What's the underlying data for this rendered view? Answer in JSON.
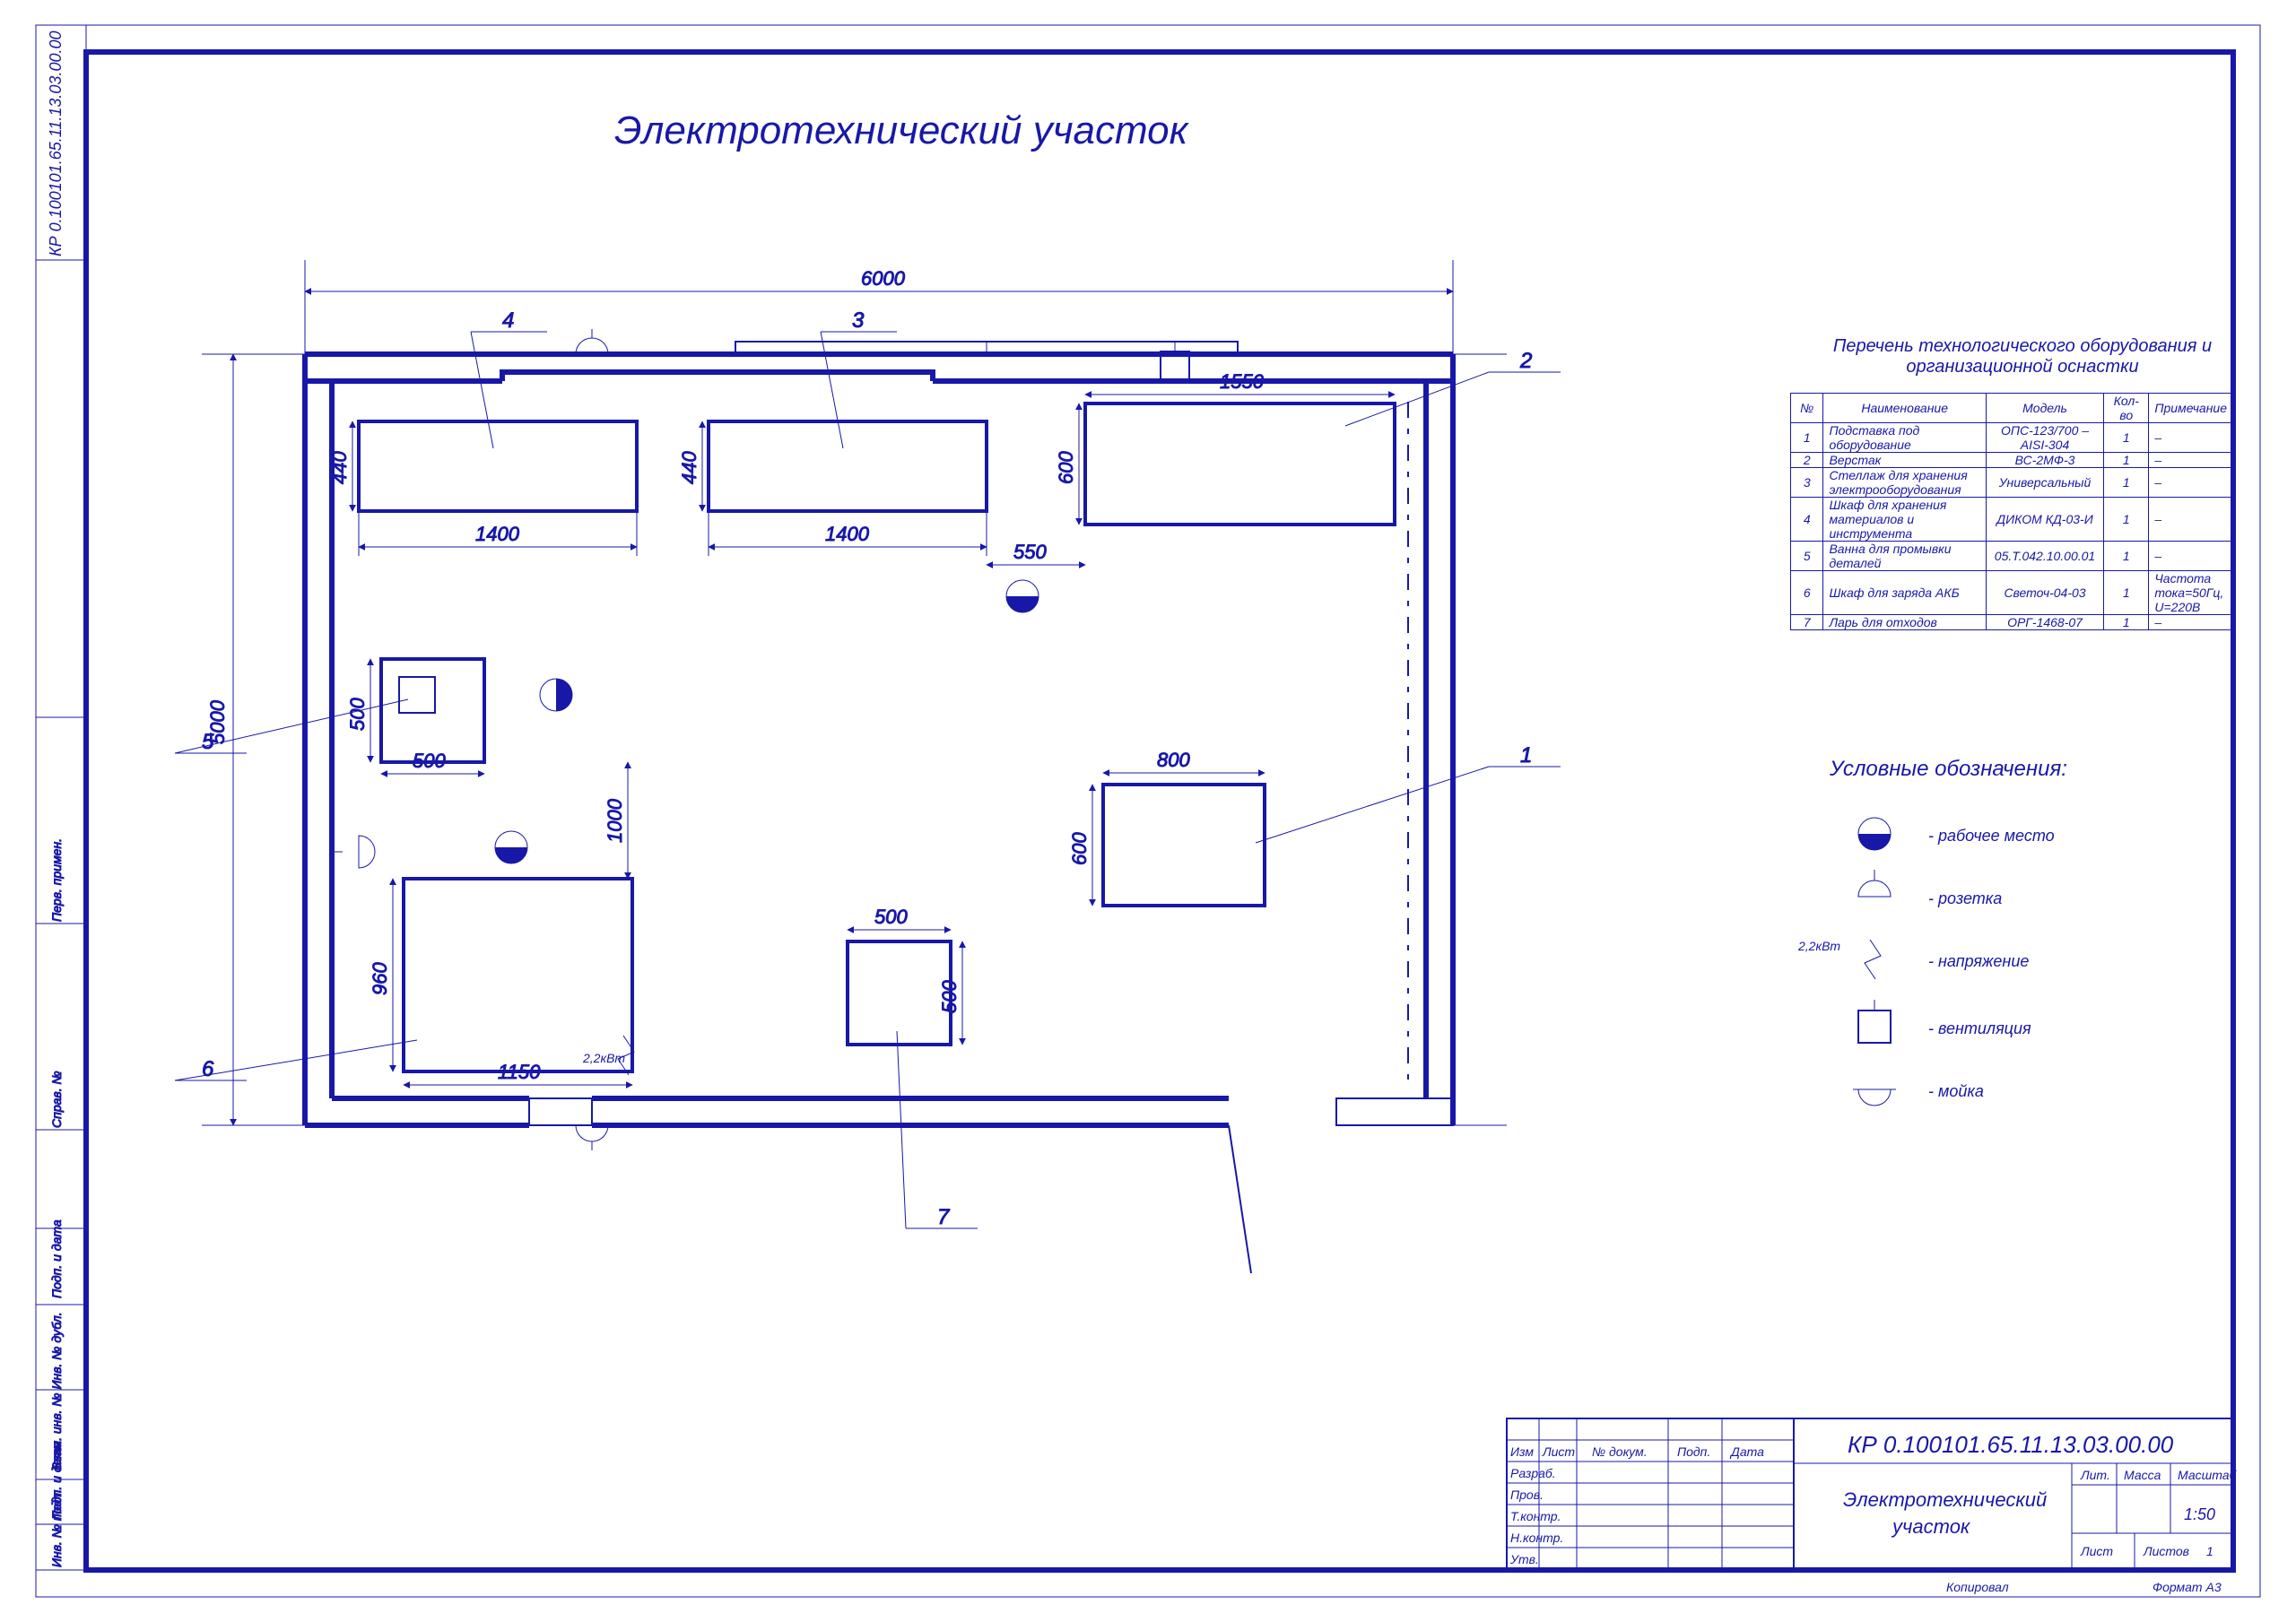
{
  "doc": {
    "title": "Электротехнический участок",
    "code_top": "КР 0.100101.65.11.13.03.00.00",
    "code_bottom": "КР 0.100101.65.11.13.03.00.00",
    "subtitle": "Электротехнический участок",
    "format": "Формат   А3",
    "copy": "Копировал",
    "scale": "1:50",
    "mass": "Масса",
    "lit": "Лит.",
    "masstab": "Масштаб",
    "list": "Лист",
    "listov": "Листов",
    "listov_val": "1"
  },
  "equip_table": {
    "title1": "Перечень технологического оборудования и",
    "title2": "организационной оснастки",
    "head": {
      "n": "№",
      "name": "Наименование",
      "model": "Модель",
      "qty": "Кол-во",
      "note": "Примечание"
    },
    "rows": [
      {
        "n": "1",
        "name": "Подставка под оборудование",
        "model": "ОПС-123/700 – AISI-304",
        "qty": "1",
        "note": "–"
      },
      {
        "n": "2",
        "name": "Верстак",
        "model": "ВС-2МФ-3",
        "qty": "1",
        "note": "–"
      },
      {
        "n": "3",
        "name": "Стеллаж для хранения электрооборудования",
        "model": "Универсальный",
        "qty": "1",
        "note": "–"
      },
      {
        "n": "4",
        "name": "Шкаф для хранения материалов и инструмента",
        "model": "ДИКОМ КД-03-И",
        "qty": "1",
        "note": "–"
      },
      {
        "n": "5",
        "name": "Ванна для промывки деталей",
        "model": "05.Т.042.10.00.01",
        "qty": "1",
        "note": "–"
      },
      {
        "n": "6",
        "name": "Шкаф для заряда АКБ",
        "model": "Светоч-04-03",
        "qty": "1",
        "note": "Частота тока=50Гц, U=220В"
      },
      {
        "n": "7",
        "name": "Ларь для отходов",
        "model": "ОРГ-1468-07",
        "qty": "1",
        "note": "–"
      }
    ]
  },
  "legend": {
    "title": "Условные обозначения:",
    "items": [
      {
        "label": "- рабочее место"
      },
      {
        "label": "- розетка"
      },
      {
        "label": "- напряжение"
      },
      {
        "label": "- вентиляция"
      },
      {
        "label": "- мойка"
      }
    ],
    "volt_label": "2,2кВт"
  },
  "dims": {
    "w": "6000",
    "h": "5000",
    "b4_w": "1400",
    "b4_h": "440",
    "b3_w": "1400",
    "b3_h": "440",
    "b2_w": "1550",
    "b2_h": "600",
    "b2_gap": "550",
    "b5_w": "500",
    "b5_h": "500",
    "b6_w": "1150",
    "b6_h": "960",
    "b6_gap": "1000",
    "b6_pwr": "2,2кВт",
    "b7_w": "500",
    "b7_h": "500",
    "b1_w": "800",
    "b1_h": "600"
  },
  "callouts": {
    "c1": "1",
    "c2": "2",
    "c3": "3",
    "c4": "4",
    "c5": "5",
    "c6": "6",
    "c7": "7"
  },
  "sidebar": {
    "a": "Инв. № подл.",
    "b": "Подп. и дата",
    "c": "Взам. инв. № Инв. № дубл.",
    "d": "Подп. и дата",
    "e": "Справ. №",
    "f": "Перв. примен."
  },
  "tblock": {
    "izm": "Изм",
    "list": "Лист",
    "ndoc": "№ докум.",
    "podp": "Подп.",
    "date": "Дата",
    "razrab": "Разраб.",
    "prov": "Пров.",
    "tkontr": "Т.контр.",
    "nkontr": "Н.контр.",
    "utv": "Утв."
  }
}
